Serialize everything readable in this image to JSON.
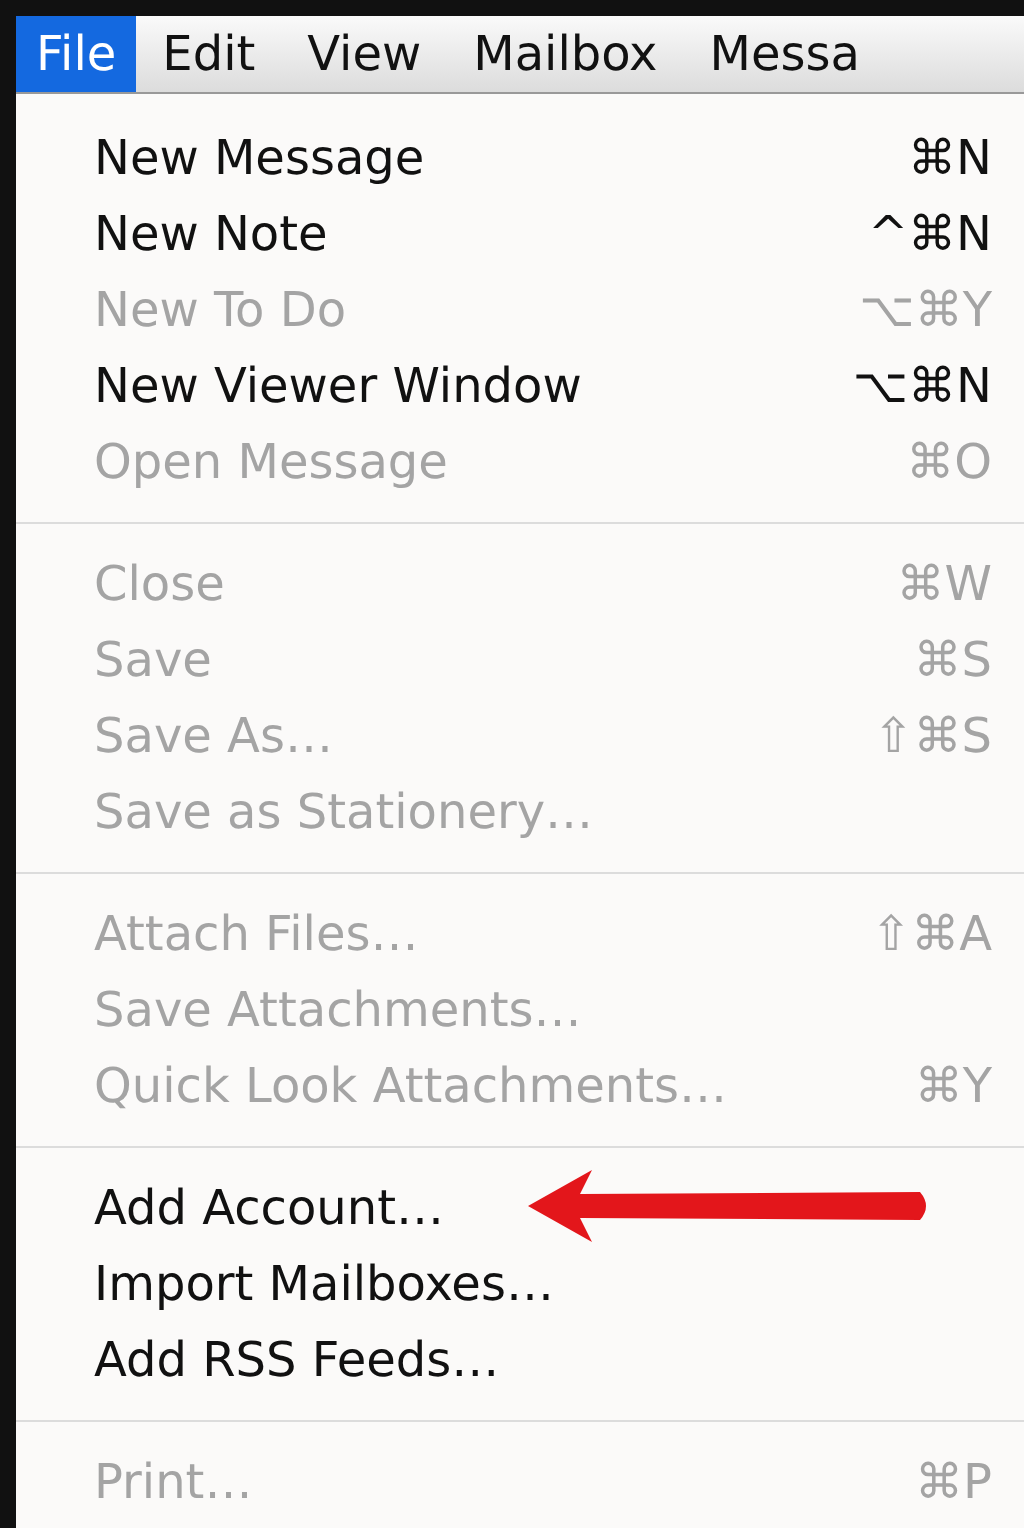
{
  "menubar": [
    {
      "label": "File",
      "selected": true
    },
    {
      "label": "Edit",
      "selected": false
    },
    {
      "label": "View",
      "selected": false
    },
    {
      "label": "Mailbox",
      "selected": false
    },
    {
      "label": "Messa",
      "selected": false
    }
  ],
  "menu": {
    "groups": [
      [
        {
          "label": "New Message",
          "shortcut": "⌘N",
          "disabled": false
        },
        {
          "label": "New Note",
          "shortcut": "^⌘N",
          "disabled": false
        },
        {
          "label": "New To Do",
          "shortcut": "⌥⌘Y",
          "disabled": true
        },
        {
          "label": "New Viewer Window",
          "shortcut": "⌥⌘N",
          "disabled": false
        },
        {
          "label": "Open Message",
          "shortcut": "⌘O",
          "disabled": true
        }
      ],
      [
        {
          "label": "Close",
          "shortcut": "⌘W",
          "disabled": true
        },
        {
          "label": "Save",
          "shortcut": "⌘S",
          "disabled": true
        },
        {
          "label": "Save As…",
          "shortcut": "⇧⌘S",
          "disabled": true
        },
        {
          "label": "Save as Stationery…",
          "disabled": true
        }
      ],
      [
        {
          "label": "Attach Files…",
          "shortcut": "⇧⌘A",
          "disabled": true
        },
        {
          "label": "Save Attachments…",
          "disabled": true
        },
        {
          "label": "Quick Look Attachments…",
          "shortcut": "⌘Y",
          "disabled": true
        }
      ],
      [
        {
          "label": "Add Account…",
          "disabled": false,
          "highlighted": true
        },
        {
          "label": "Import Mailboxes…",
          "disabled": false
        },
        {
          "label": "Add RSS Feeds…",
          "disabled": false
        }
      ],
      [
        {
          "label": "Print…",
          "shortcut": "⌘P",
          "disabled": true
        }
      ]
    ]
  }
}
